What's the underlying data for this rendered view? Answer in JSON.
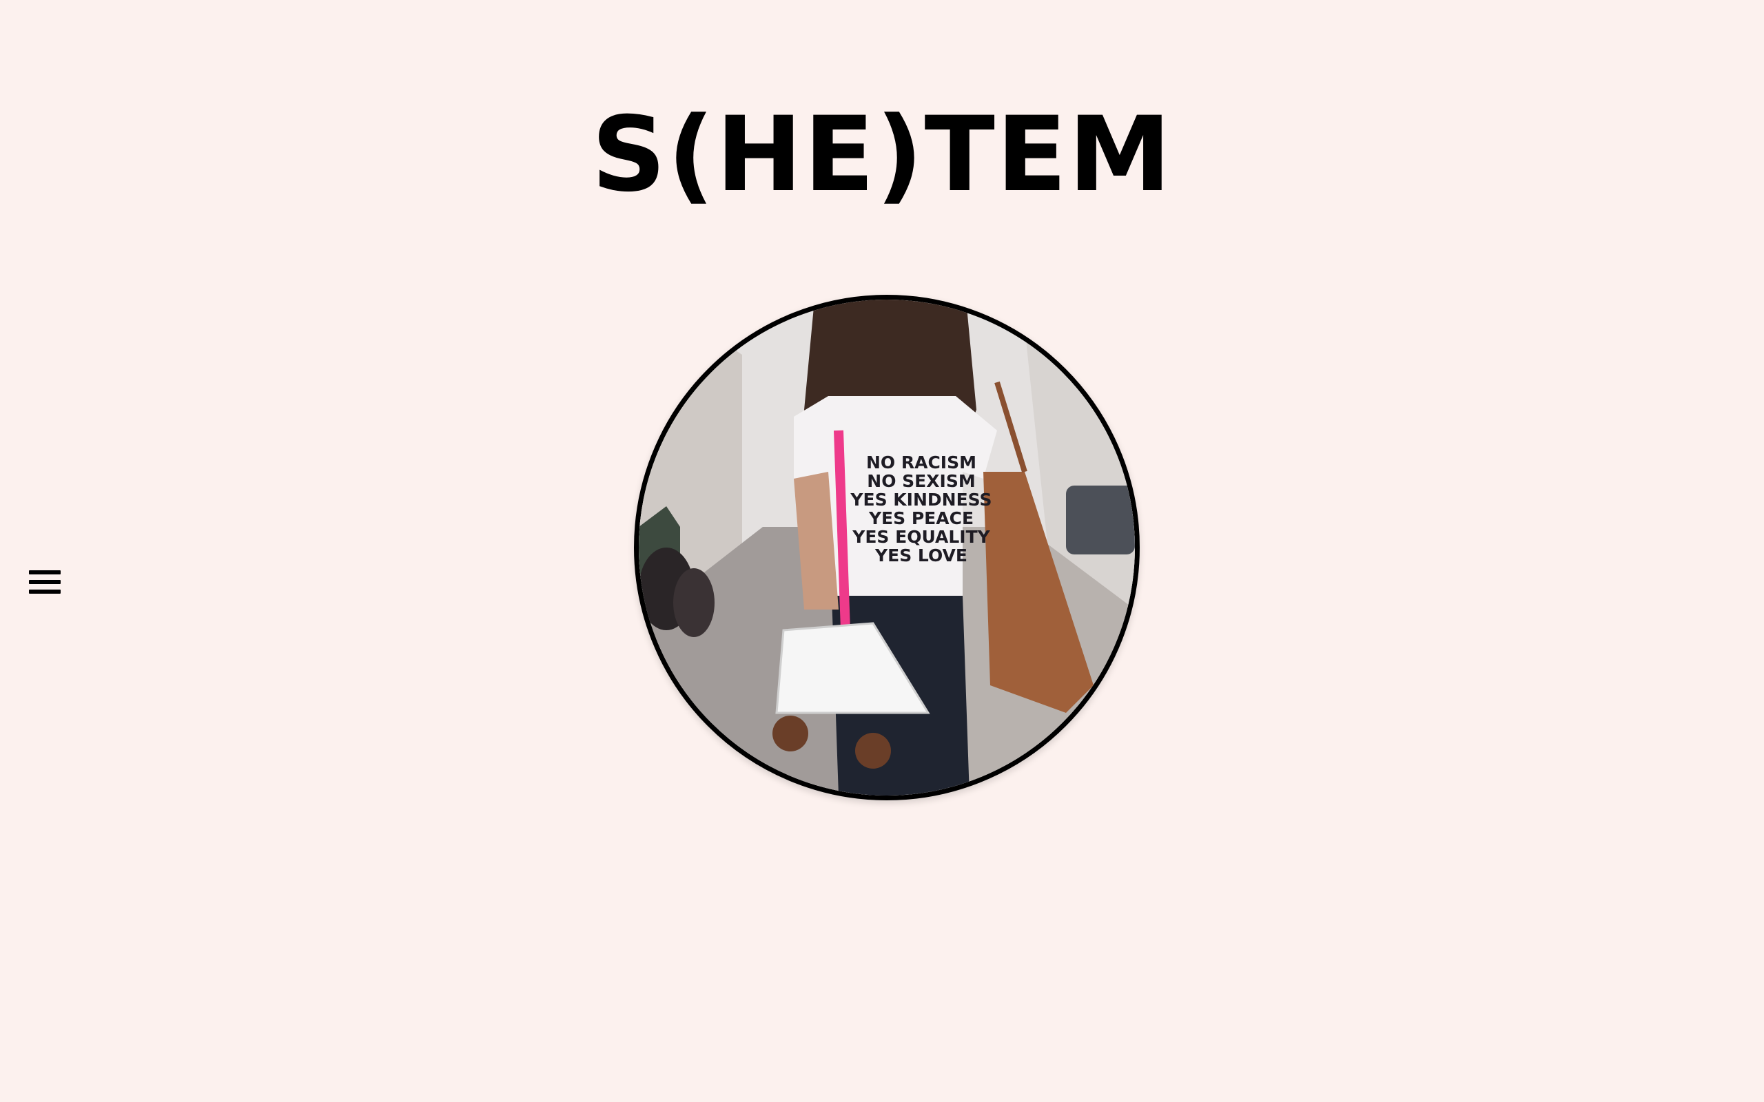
{
  "header": {
    "brand_title": "S(HE)TEM"
  },
  "navigation": {
    "menu_icon": "hamburger-menu-icon"
  },
  "hero": {
    "shirt_lines": [
      "NO RACISM",
      "NO SEXISM",
      "YES KINDNESS",
      "YES PEACE",
      "YES EQUALITY",
      "YES LOVE"
    ]
  },
  "colors": {
    "background": "#fcf1ee",
    "text": "#000000",
    "ring": "#000000"
  }
}
